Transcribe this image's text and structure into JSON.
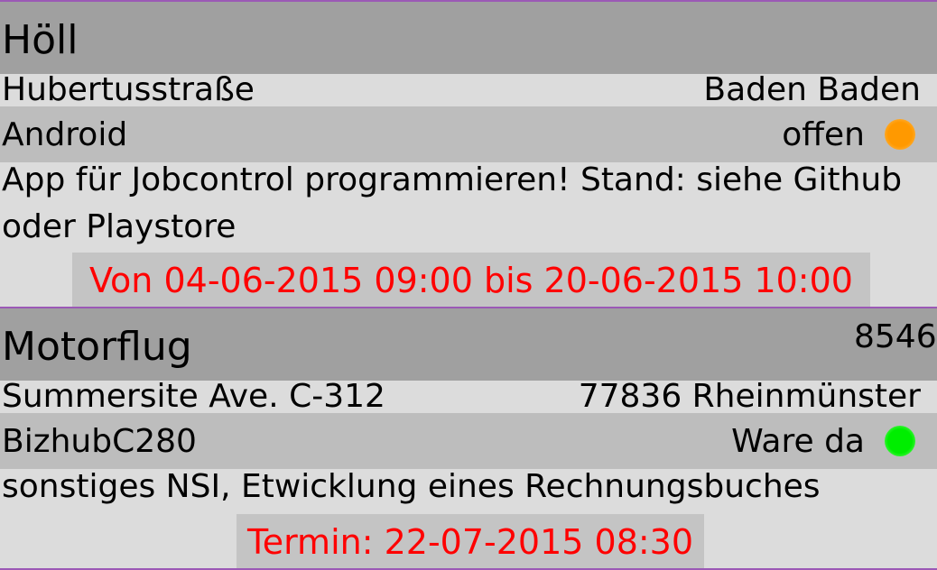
{
  "colors": {
    "divider": "#9b59b6",
    "title_background": "#a0a0a0",
    "row_light": "#dcdcdc",
    "row_mid": "#bdbdbd",
    "date_text": "#ff0000",
    "status_open": "#ff9900",
    "status_ready": "#00ee00"
  },
  "jobs": [
    {
      "title": "Höll",
      "number": "",
      "street": "Hubertusstraße",
      "city": "Baden Baden",
      "device": "Android",
      "status": "offen",
      "status_icon": "status-dot-orange",
      "description": "App für Jobcontrol programmieren! Stand: siehe Github oder Playstore",
      "date": "Von 04-06-2015  09:00 bis 20-06-2015  10:00"
    },
    {
      "title": "Motorflug",
      "number": "8546",
      "street": "Summersite Ave. C-312",
      "city": "77836 Rheinmünster",
      "device": "BizhubC280",
      "status": "Ware da",
      "status_icon": "status-dot-green",
      "description": "sonstiges NSI, Etwicklung eines Rechnungsbuches",
      "date": "Termin: 22-07-2015  08:30"
    }
  ]
}
